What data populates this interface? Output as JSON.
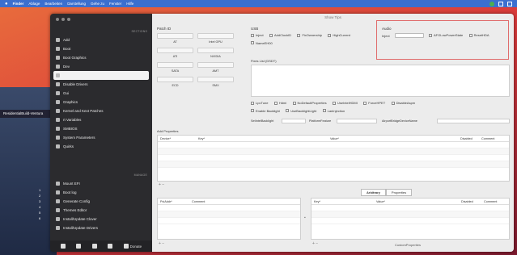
{
  "menubar": {
    "app": "Finder",
    "items": [
      "Ablage",
      "Bearbeiten",
      "Darstellung",
      "Gehe zu",
      "Fenster",
      "Hilfe"
    ]
  },
  "desktop": {
    "terminal_text": "ResidentialBuild-Ventura",
    "numbers": [
      "1",
      "2",
      "3",
      "4",
      "5",
      "6"
    ]
  },
  "window": {
    "title": "Show Tips"
  },
  "sidebar": {
    "section_top": "SECTIONS",
    "items": [
      {
        "label": "Add",
        "icon": "add-icon"
      },
      {
        "label": "Boot",
        "icon": "boot-icon"
      },
      {
        "label": "Boot Graphics",
        "icon": "graphics-icon"
      },
      {
        "label": "Dev",
        "icon": "dev-icon"
      },
      {
        "label": "",
        "icon": "selected-icon"
      },
      {
        "label": "Disable Drivers",
        "icon": "driver-icon"
      },
      {
        "label": "Gui",
        "icon": "gui-icon"
      },
      {
        "label": "Graphics",
        "icon": "graphics-icon"
      },
      {
        "label": "Kernel and Kext Patches",
        "icon": "kernel-icon"
      },
      {
        "label": "rt Variables",
        "icon": "variables-icon"
      },
      {
        "label": "SMBIOS",
        "icon": "smbios-icon"
      },
      {
        "label": "System Parameters",
        "icon": "system-icon"
      },
      {
        "label": "Quirks",
        "icon": "quirks-icon"
      }
    ],
    "section_bottom": "MANAGE",
    "tools": [
      {
        "label": "Mount EFI",
        "icon": "disk-icon"
      },
      {
        "label": "Boot log",
        "icon": "log-icon"
      },
      {
        "label": "Generate Config",
        "icon": "wand-icon"
      },
      {
        "label": "Themes Editor",
        "icon": "palette-icon"
      },
      {
        "label": "Install/Update Clover",
        "icon": "install-icon"
      },
      {
        "label": "Install/Update Drivers",
        "icon": "drivers-icon"
      }
    ],
    "donate": "Donate"
  },
  "panels": {
    "patch_title": "Patch ID",
    "patch_buttons": [
      "AT",
      "Intel GPU",
      "ATI",
      "NVIDIA",
      "SATA",
      "AMT",
      "ECD",
      "SMX"
    ],
    "usb_title": "USB",
    "usb_options": [
      "Inject",
      "AddClockID",
      "FixOwnership",
      "HighCurrent",
      "NameEH00"
    ],
    "audio_title": "Audio",
    "audio_inject_label": "Inject",
    "audio_options": [
      "AFGLowPowerState",
      "ResetHDA"
    ],
    "fix_list_title": "Fixes List (DSDT)",
    "gfx_options": [
      "LpcTune",
      "Hdmi",
      "NoDefaultProperties",
      "UseIntelHDMI",
      "ForceHPET",
      "DisableAspm",
      "Enable Backlight",
      "UseBacklightLight",
      "LanInjection"
    ],
    "field_labels": [
      "SetIntelBacklight",
      "PlatformFeature",
      "AirportBridgeDeviceName"
    ],
    "add_properties_title": "Add Properties",
    "add_props_cols": [
      "Device*",
      "Key*",
      "Value*",
      "Disabled",
      "Comment"
    ],
    "tabs": [
      "Arbitrary",
      "Properties"
    ],
    "left_table_cols": [
      "PciAddr*",
      "Comment"
    ],
    "right_table_cols": [
      "Key*",
      "Value*",
      "Disabled",
      "Comment"
    ],
    "custom_properties": "CustomProperties"
  }
}
